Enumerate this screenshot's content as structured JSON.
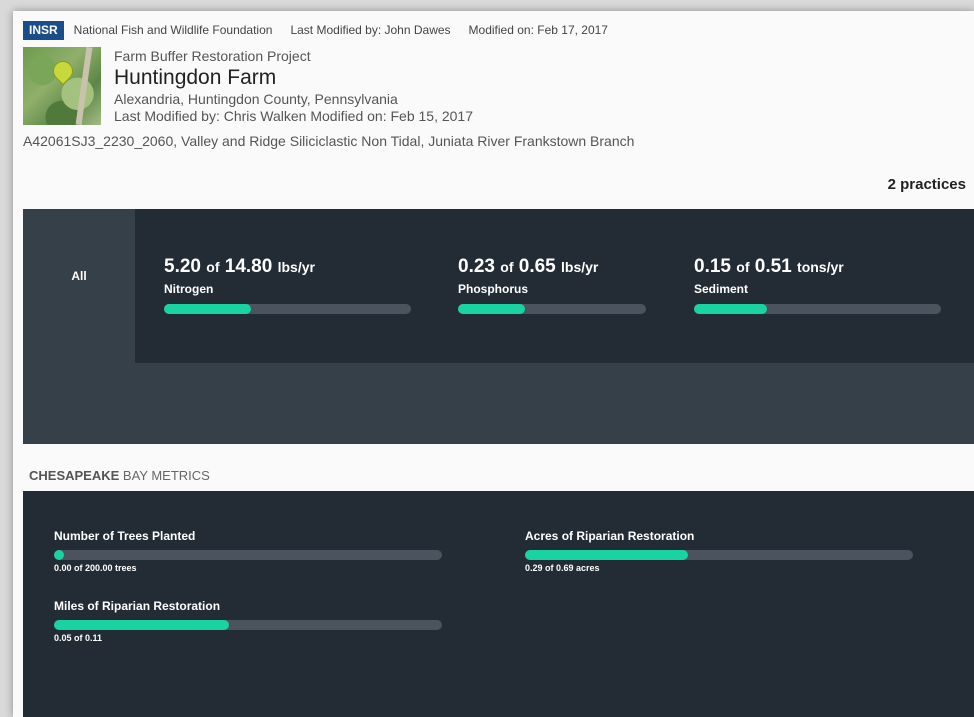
{
  "header": {
    "badge": "INSR",
    "organization": "National Fish and Wildlife Foundation",
    "last_modified": "Last Modified by: John Dawes",
    "modified_on": "Modified on: Feb 17, 2017"
  },
  "project": {
    "subtitle": "Farm Buffer Restoration Project",
    "title": "Huntingdon Farm",
    "location": "Alexandria, Huntingdon County, Pennsylvania",
    "modified": "Last Modified by: Chris Walken Modified on: Feb 15, 2017",
    "codes": "A42061SJ3_2230_2060, Valley and Ridge Siliciclastic Non Tidal, Juniata River Frankstown Branch"
  },
  "practices_count": "2 practices",
  "load_metrics": {
    "tab_all": "All",
    "items": [
      {
        "value": "5.20",
        "of": "of",
        "total": "14.80",
        "unit": "lbs/yr",
        "label": "Nitrogen",
        "progress": 0.351
      },
      {
        "value": "0.23",
        "of": "of",
        "total": "0.65",
        "unit": "lbs/yr",
        "label": "Phosphorus",
        "progress": 0.354
      },
      {
        "value": "0.15",
        "of": "of",
        "total": "0.51",
        "unit": "tons/yr",
        "label": "Sediment",
        "progress": 0.294
      }
    ]
  },
  "chesapeake": {
    "heading_bold": "CHESAPEAKE",
    "heading_rest": " BAY METRICS",
    "items": [
      {
        "label": "Number of Trees Planted",
        "detail": "0.00 of 200.00 trees",
        "progress": 0.0
      },
      {
        "label": "Acres of Riparian Restoration",
        "detail": "0.29 of 0.69 acres",
        "progress": 0.42
      },
      {
        "label": "Miles of Riparian Restoration",
        "detail": "0.05 of 0.11",
        "progress": 0.45
      }
    ]
  },
  "colors": {
    "accent": "#19d3a2",
    "panel_dark": "#232c35",
    "panel_mid": "#364049",
    "badge": "#1a4e8a"
  }
}
